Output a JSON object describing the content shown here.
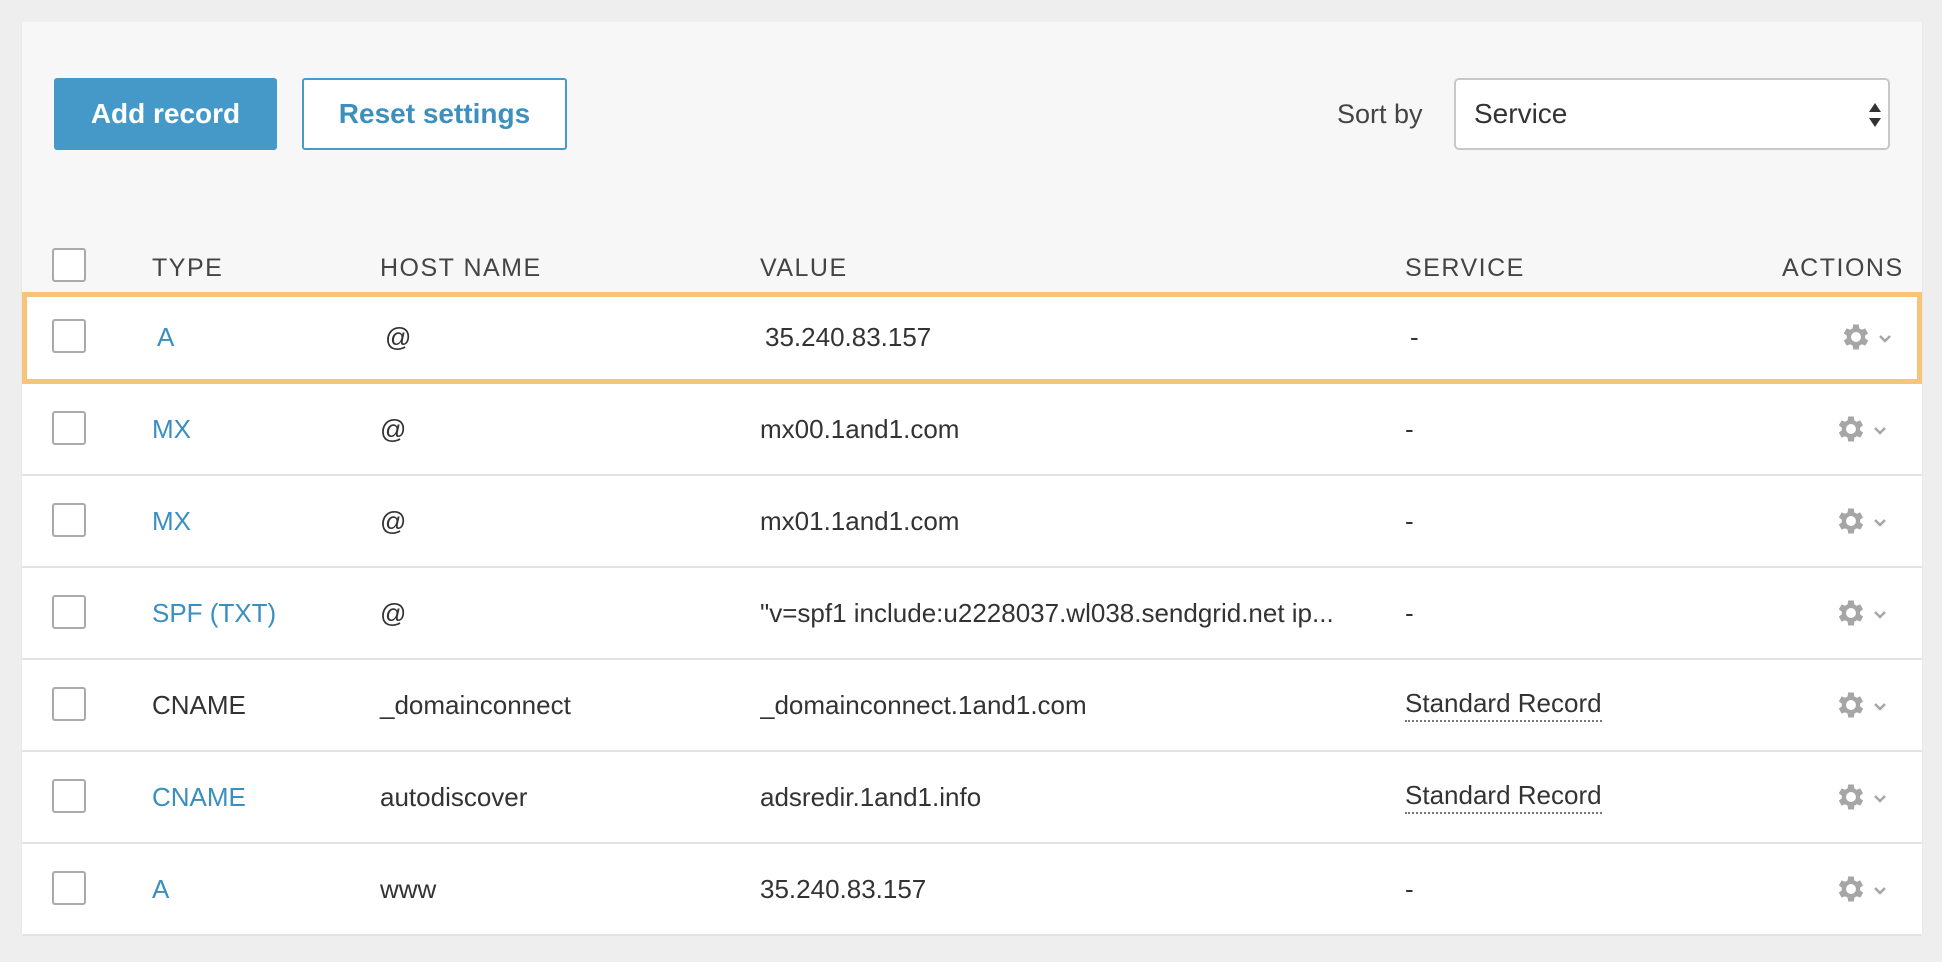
{
  "toolbar": {
    "add_label": "Add record",
    "reset_label": "Reset settings",
    "sort_label": "Sort by",
    "sort_value": "Service"
  },
  "table": {
    "headers": {
      "type": "TYPE",
      "host": "HOST NAME",
      "value": "VALUE",
      "service": "SERVICE",
      "actions": "ACTIONS"
    },
    "rows": [
      {
        "type": "A",
        "host": "@",
        "value": "35.240.83.157",
        "service": "-"
      },
      {
        "type": "MX",
        "host": "@",
        "value": "mx00.1and1.com",
        "service": "-"
      },
      {
        "type": "MX",
        "host": "@",
        "value": "mx01.1and1.com",
        "service": "-"
      },
      {
        "type": "SPF (TXT)",
        "host": "@",
        "value": "\"v=spf1 include:u2228037.wl038.sendgrid.net ip...",
        "service": "-"
      },
      {
        "type": "CNAME",
        "host": "_domainconnect",
        "value": "_domainconnect.1and1.com",
        "service": "Standard Record"
      },
      {
        "type": "CNAME",
        "host": "autodiscover",
        "value": "adsredir.1and1.info",
        "service": "Standard Record"
      },
      {
        "type": "A",
        "host": "www",
        "value": "35.240.83.157",
        "service": "-"
      }
    ]
  },
  "colors": {
    "accent": "#4499c9",
    "link": "#3a8fc0",
    "highlight_border": "#f8c47a",
    "icon_gray": "#a6a6a6"
  },
  "icons": {
    "actions": "gear-icon",
    "dropdown": "chevron-down-icon",
    "select": "sort-arrows-icon"
  }
}
